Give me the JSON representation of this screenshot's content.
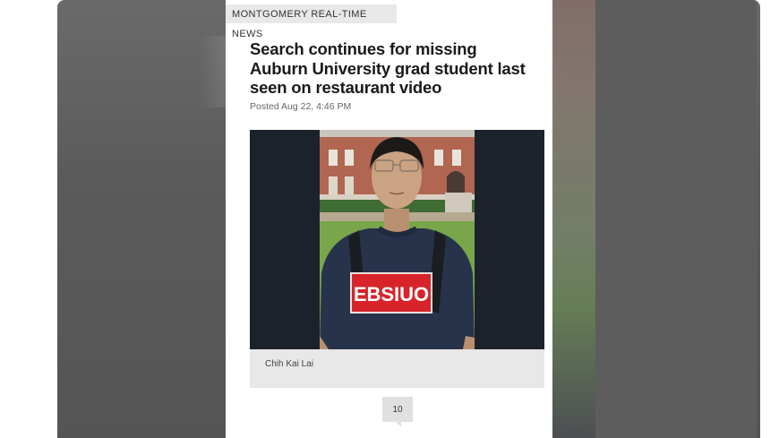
{
  "section": {
    "label": "MONTGOMERY REAL-TIME NEWS"
  },
  "article": {
    "headline": "Search continues for missing Auburn University grad student last seen on restaurant video",
    "posted": "Posted Aug 22, 4:46 PM",
    "caption": "Chih Kai Lai",
    "shirt_text": "EBSIUO",
    "comment_count": "10"
  },
  "colors": {
    "tag_bg": "#e8e8e8",
    "photo_bg": "#1c222b",
    "shirt_label": "#d6242a"
  }
}
